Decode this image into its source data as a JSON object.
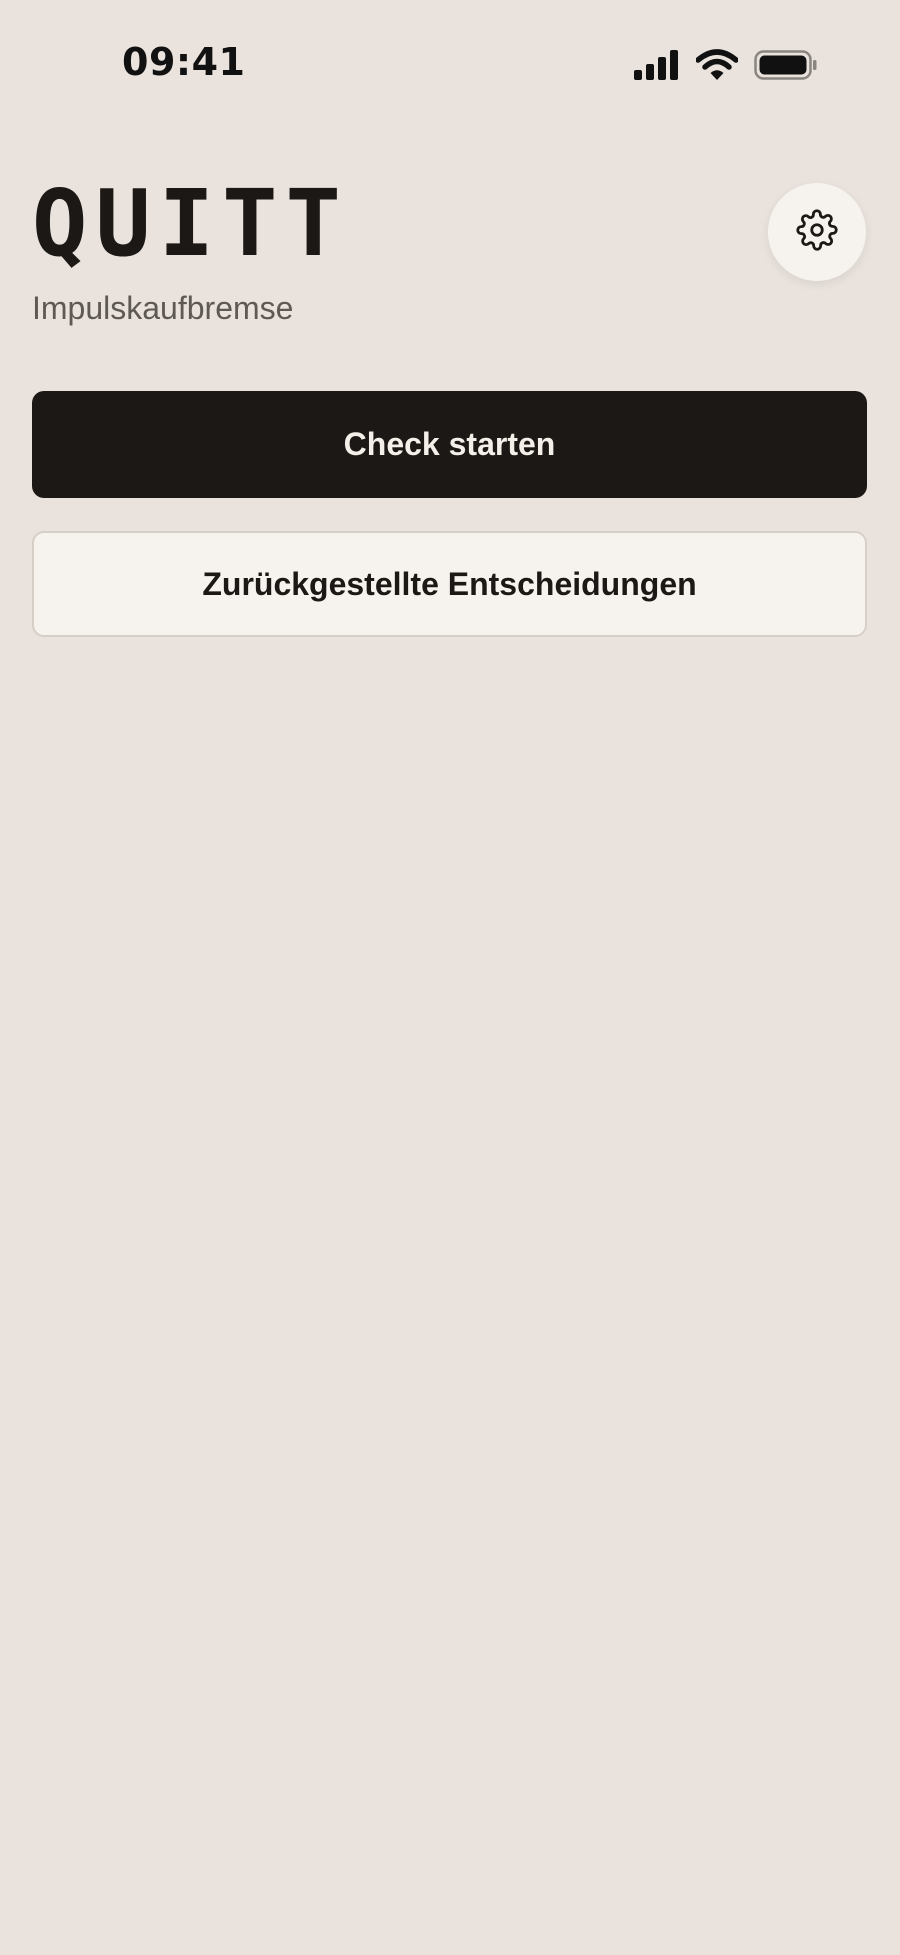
{
  "status_bar": {
    "time": "09:41",
    "icons": [
      "cellular-signal-icon",
      "wifi-icon",
      "battery-icon"
    ]
  },
  "header": {
    "title": "QUITT",
    "subtitle": "Impulskaufbremse",
    "settings_icon": "gear-icon"
  },
  "actions": {
    "primary_label": "Check starten",
    "secondary_label": "Zurückgestellte Entscheidungen"
  },
  "colors": {
    "background": "#EAE3DD",
    "primary_button": "#1C1815",
    "surface": "#F6F3EE",
    "text": "#1C1815",
    "muted_text": "#5E5953"
  }
}
